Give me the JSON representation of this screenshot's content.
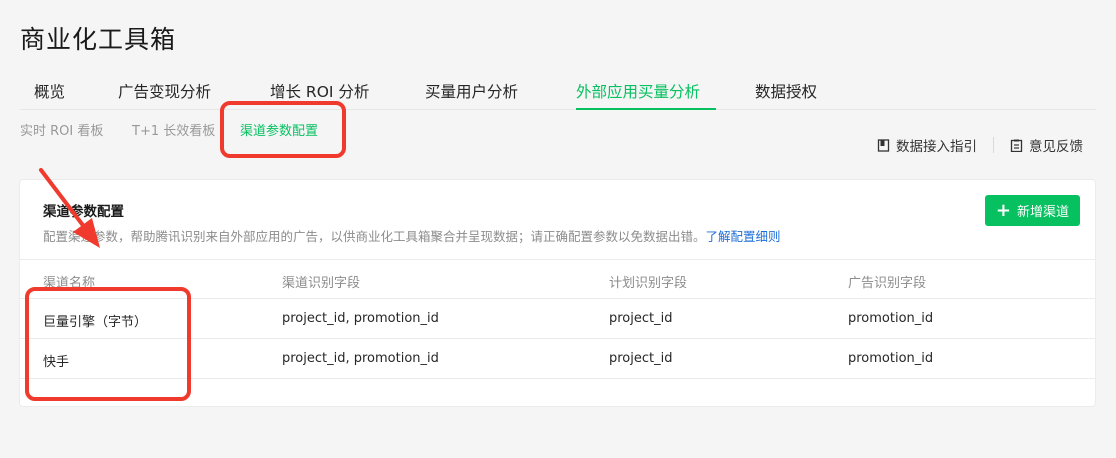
{
  "app_title": "商业化工具箱",
  "tabs": [
    {
      "label": "概览"
    },
    {
      "label": "广告变现分析"
    },
    {
      "label": "增长 ROI 分析"
    },
    {
      "label": "买量用户分析"
    },
    {
      "label": "外部应用买量分析"
    },
    {
      "label": "数据授权"
    }
  ],
  "subtabs": [
    {
      "label": "实时 ROI 看板"
    },
    {
      "label": "T+1 长效看板"
    },
    {
      "label": "渠道参数配置"
    }
  ],
  "toplinks": {
    "guide": "数据接入指引",
    "feedback": "意见反馈"
  },
  "card": {
    "title": "渠道参数配置",
    "desc": "配置渠道参数，帮助腾讯识别来自外部应用的广告，以供商业化工具箱聚合并呈现数据；请正确配置参数以免数据出错。",
    "desc_link": "了解配置细则",
    "add_button": "新增渠道"
  },
  "table": {
    "headers": [
      "渠道名称",
      "渠道识别字段",
      "计划识别字段",
      "广告识别字段"
    ],
    "rows": [
      [
        "巨量引擎（字节）",
        "project_id, promotion_id",
        "project_id",
        "promotion_id"
      ],
      [
        "快手",
        "project_id, promotion_id",
        "project_id",
        "promotion_id"
      ]
    ]
  },
  "colors": {
    "accent": "#07c160",
    "annotation": "#ef3a2d",
    "link": "#1e6fd9"
  }
}
